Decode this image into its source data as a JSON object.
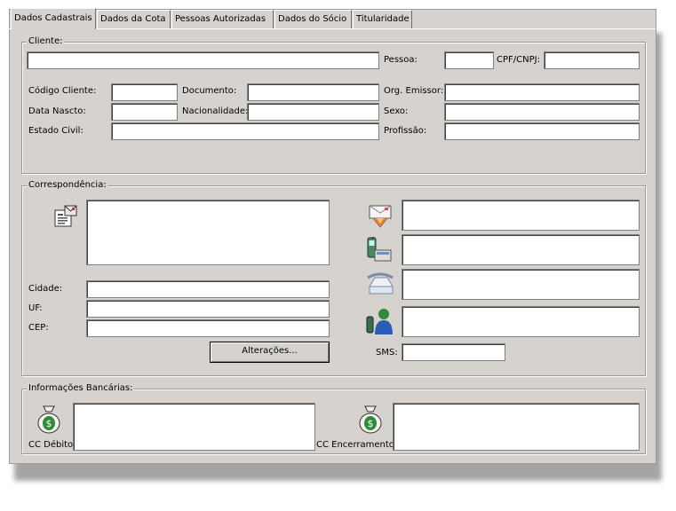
{
  "tabs": [
    {
      "label": "Dados Cadastrais"
    },
    {
      "label": "Dados da Cota"
    },
    {
      "label": "Pessoas Autorizadas"
    },
    {
      "label": "Dados do Sócio"
    },
    {
      "label": "Titularidade"
    }
  ],
  "cliente": {
    "legend": "Cliente:",
    "nome_value": "",
    "pessoa_label": "Pessoa:",
    "pessoa_value": "",
    "cpf_label": "CPF/CNPJ:",
    "cpf_value": "",
    "codigo_label": "Código Cliente:",
    "codigo_value": "",
    "documento_label": "Documento:",
    "documento_value": "",
    "orgao_label": "Org. Emissor:",
    "orgao_value": "",
    "nascto_label": "Data Nascto:",
    "nascto_value": "",
    "nacionalidade_label": "Nacionalidade:",
    "nacionalidade_value": "",
    "sexo_label": "Sexo:",
    "sexo_value": "",
    "civil_label": "Estado Civil:",
    "civil_value": "",
    "profissao_label": "Profissão:",
    "profissao_value": ""
  },
  "correspondencia": {
    "legend": "Correspondência:",
    "address_icon": "address-card-icon",
    "endereco_value": "",
    "cidade_label": "Cidade:",
    "cidade_value": "",
    "uf_label": "UF:",
    "uf_value": "",
    "cep_label": "CEP:",
    "cep_value": "",
    "alteracoes_label": "Alterações...",
    "email_icon": "email-icon",
    "email_value": "",
    "mobile_icon": "mobile-phone-icon",
    "celular_value": "",
    "phone_icon": "telephone-icon",
    "telefone_value": "",
    "messenger_icon": "messenger-icon",
    "messenger_value": "",
    "sms_label": "SMS:",
    "sms_value": ""
  },
  "bancarias": {
    "legend": "Informações Bancárias:",
    "money_icon": "money-bag-icon",
    "debito_label": "CC Débito",
    "debito_value": "",
    "encerramento_label": "CC Encerramento",
    "encerramento_value": ""
  }
}
